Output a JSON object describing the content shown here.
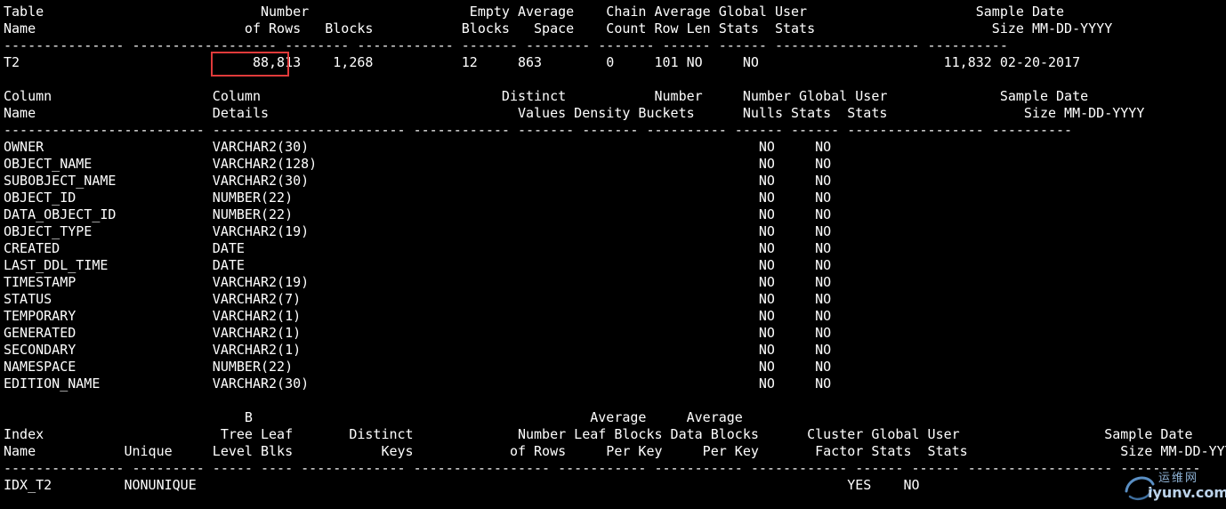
{
  "terminal": {
    "lines": [
      "Table                           Number                    Empty Average    Chain Average Global User                     Sample Date",
      "Name                          of Rows   Blocks           Blocks   Space    Count Row Len Stats  Stats                      Size MM-DD-YYYY",
      "--------------- ------------------ -------- ------------ ------- -------- ------- ------ ------ ------------------ ----------",
      "T2                             88,813    1,268           12     863        0     101 NO     NO                       11,832 02-20-2017",
      "",
      "Column                    Column                              Distinct           Number     Number Global User              Sample Date",
      "Name                      Details                               Values Density Buckets      Nulls Stats  Stats                 Size MM-DD-YYYY",
      "------------------------- ------------------------ ------------ ------- ------- ---------- ------ ------ ----------------- ----------",
      "OWNER                     VARCHAR2(30)                                                        NO     NO",
      "OBJECT_NAME               VARCHAR2(128)                                                       NO     NO",
      "SUBOBJECT_NAME            VARCHAR2(30)                                                        NO     NO",
      "OBJECT_ID                 NUMBER(22)                                                          NO     NO",
      "DATA_OBJECT_ID            NUMBER(22)                                                          NO     NO",
      "OBJECT_TYPE               VARCHAR2(19)                                                        NO     NO",
      "CREATED                   DATE                                                                NO     NO",
      "LAST_DDL_TIME             DATE                                                                NO     NO",
      "TIMESTAMP                 VARCHAR2(19)                                                        NO     NO",
      "STATUS                    VARCHAR2(7)                                                         NO     NO",
      "TEMPORARY                 VARCHAR2(1)                                                         NO     NO",
      "GENERATED                 VARCHAR2(1)                                                         NO     NO",
      "SECONDARY                 VARCHAR2(1)                                                         NO     NO",
      "NAMESPACE                 NUMBER(22)                                                          NO     NO",
      "EDITION_NAME              VARCHAR2(30)                                                        NO     NO",
      "",
      "                              B                                          Average     Average",
      "Index                      Tree Leaf       Distinct             Number Leaf Blocks Data Blocks      Cluster Global User                  Sample Date",
      "Name           Unique     Level Blks           Keys            of Rows     Per Key     Per Key       Factor Stats  Stats                   Size MM-DD-YYYY",
      "--------------- --------- ----- ---- ------------- ----------------- ----------- ----------- ------------ ------ ------ ------------------ ----------",
      "IDX_T2         NONUNIQUE                                                                                 YES    NO"
    ]
  },
  "highlight": {
    "color": "#e03a3a"
  },
  "watermark": {
    "cn_text": "运维网",
    "domain": "iyunv.com"
  }
}
